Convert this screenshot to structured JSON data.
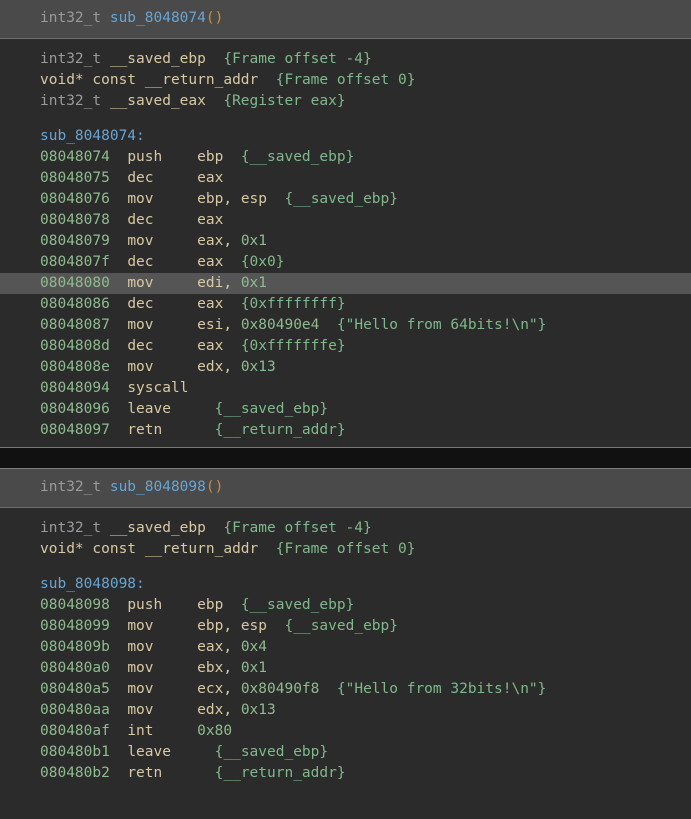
{
  "view": {
    "name": "disassembly-view",
    "background": "#2b2b2b",
    "header_background": "#4a4a4a",
    "separator_background": "#111111",
    "highlight_background": "#555555",
    "colors": {
      "address": "#8fbc8f",
      "mnemonic": "#d8c9a3",
      "comment": "#7fb98a",
      "function_name": "#68a5d4",
      "type": "#9a9a9a",
      "paren": "#c8903f"
    }
  },
  "functions": [
    {
      "header": {
        "return_type": "int32_t",
        "name": "sub_8048074",
        "parens": "()"
      },
      "variables": [
        {
          "type": "int32_t",
          "qualifier": "",
          "name": "__saved_ebp",
          "comment": "{Frame offset -4}"
        },
        {
          "type": "void*",
          "qualifier": "const",
          "name": "__return_addr",
          "comment": "{Frame offset 0}"
        },
        {
          "type": "int32_t",
          "qualifier": "",
          "name": "__saved_eax",
          "comment": "{Register eax}"
        }
      ],
      "label": "sub_8048074:",
      "instructions": [
        {
          "address": "08048074",
          "mnemonic": "push",
          "operands": "ebp",
          "comment": "{__saved_ebp}",
          "highlighted": false
        },
        {
          "address": "08048075",
          "mnemonic": "dec",
          "operands": "eax",
          "comment": "",
          "highlighted": false
        },
        {
          "address": "08048076",
          "mnemonic": "mov",
          "operands": "ebp, esp",
          "comment": "{__saved_ebp}",
          "highlighted": false
        },
        {
          "address": "08048078",
          "mnemonic": "dec",
          "operands": "eax",
          "comment": "",
          "highlighted": false
        },
        {
          "address": "08048079",
          "mnemonic": "mov",
          "operands": "eax, 0x1",
          "comment": "",
          "highlighted": false
        },
        {
          "address": "0804807f",
          "mnemonic": "dec",
          "operands": "eax",
          "comment": "{0x0}",
          "highlighted": false
        },
        {
          "address": "08048080",
          "mnemonic": "mov",
          "operands": "edi, 0x1",
          "comment": "",
          "highlighted": true
        },
        {
          "address": "08048086",
          "mnemonic": "dec",
          "operands": "eax",
          "comment": "{0xffffffff}",
          "highlighted": false
        },
        {
          "address": "08048087",
          "mnemonic": "mov",
          "operands": "esi, 0x80490e4",
          "comment": "{\"Hello from 64bits!\\n\"}",
          "highlighted": false
        },
        {
          "address": "0804808d",
          "mnemonic": "dec",
          "operands": "eax",
          "comment": "{0xfffffffe}",
          "highlighted": false
        },
        {
          "address": "0804808e",
          "mnemonic": "mov",
          "operands": "edx, 0x13",
          "comment": "",
          "highlighted": false
        },
        {
          "address": "08048094",
          "mnemonic": "syscall",
          "operands": "",
          "comment": "",
          "highlighted": false
        },
        {
          "address": "08048096",
          "mnemonic": "leave",
          "operands": "",
          "comment": "{__saved_ebp}",
          "highlighted": false
        },
        {
          "address": "08048097",
          "mnemonic": "retn",
          "operands": "",
          "comment": "{__return_addr}",
          "highlighted": false
        }
      ]
    },
    {
      "header": {
        "return_type": "int32_t",
        "name": "sub_8048098",
        "parens": "()"
      },
      "variables": [
        {
          "type": "int32_t",
          "qualifier": "",
          "name": "__saved_ebp",
          "comment": "{Frame offset -4}"
        },
        {
          "type": "void*",
          "qualifier": "const",
          "name": "__return_addr",
          "comment": "{Frame offset 0}"
        }
      ],
      "label": "sub_8048098:",
      "instructions": [
        {
          "address": "08048098",
          "mnemonic": "push",
          "operands": "ebp",
          "comment": "{__saved_ebp}",
          "highlighted": false
        },
        {
          "address": "08048099",
          "mnemonic": "mov",
          "operands": "ebp, esp",
          "comment": "{__saved_ebp}",
          "highlighted": false
        },
        {
          "address": "0804809b",
          "mnemonic": "mov",
          "operands": "eax, 0x4",
          "comment": "",
          "highlighted": false
        },
        {
          "address": "080480a0",
          "mnemonic": "mov",
          "operands": "ebx, 0x1",
          "comment": "",
          "highlighted": false
        },
        {
          "address": "080480a5",
          "mnemonic": "mov",
          "operands": "ecx, 0x80490f8",
          "comment": "{\"Hello from 32bits!\\n\"}",
          "highlighted": false
        },
        {
          "address": "080480aa",
          "mnemonic": "mov",
          "operands": "edx, 0x13",
          "comment": "",
          "highlighted": false
        },
        {
          "address": "080480af",
          "mnemonic": "int",
          "operands": "0x80",
          "comment": "",
          "highlighted": false
        },
        {
          "address": "080480b1",
          "mnemonic": "leave",
          "operands": "",
          "comment": "{__saved_ebp}",
          "highlighted": false
        },
        {
          "address": "080480b2",
          "mnemonic": "retn",
          "operands": "",
          "comment": "{__return_addr}",
          "highlighted": false
        }
      ]
    }
  ]
}
